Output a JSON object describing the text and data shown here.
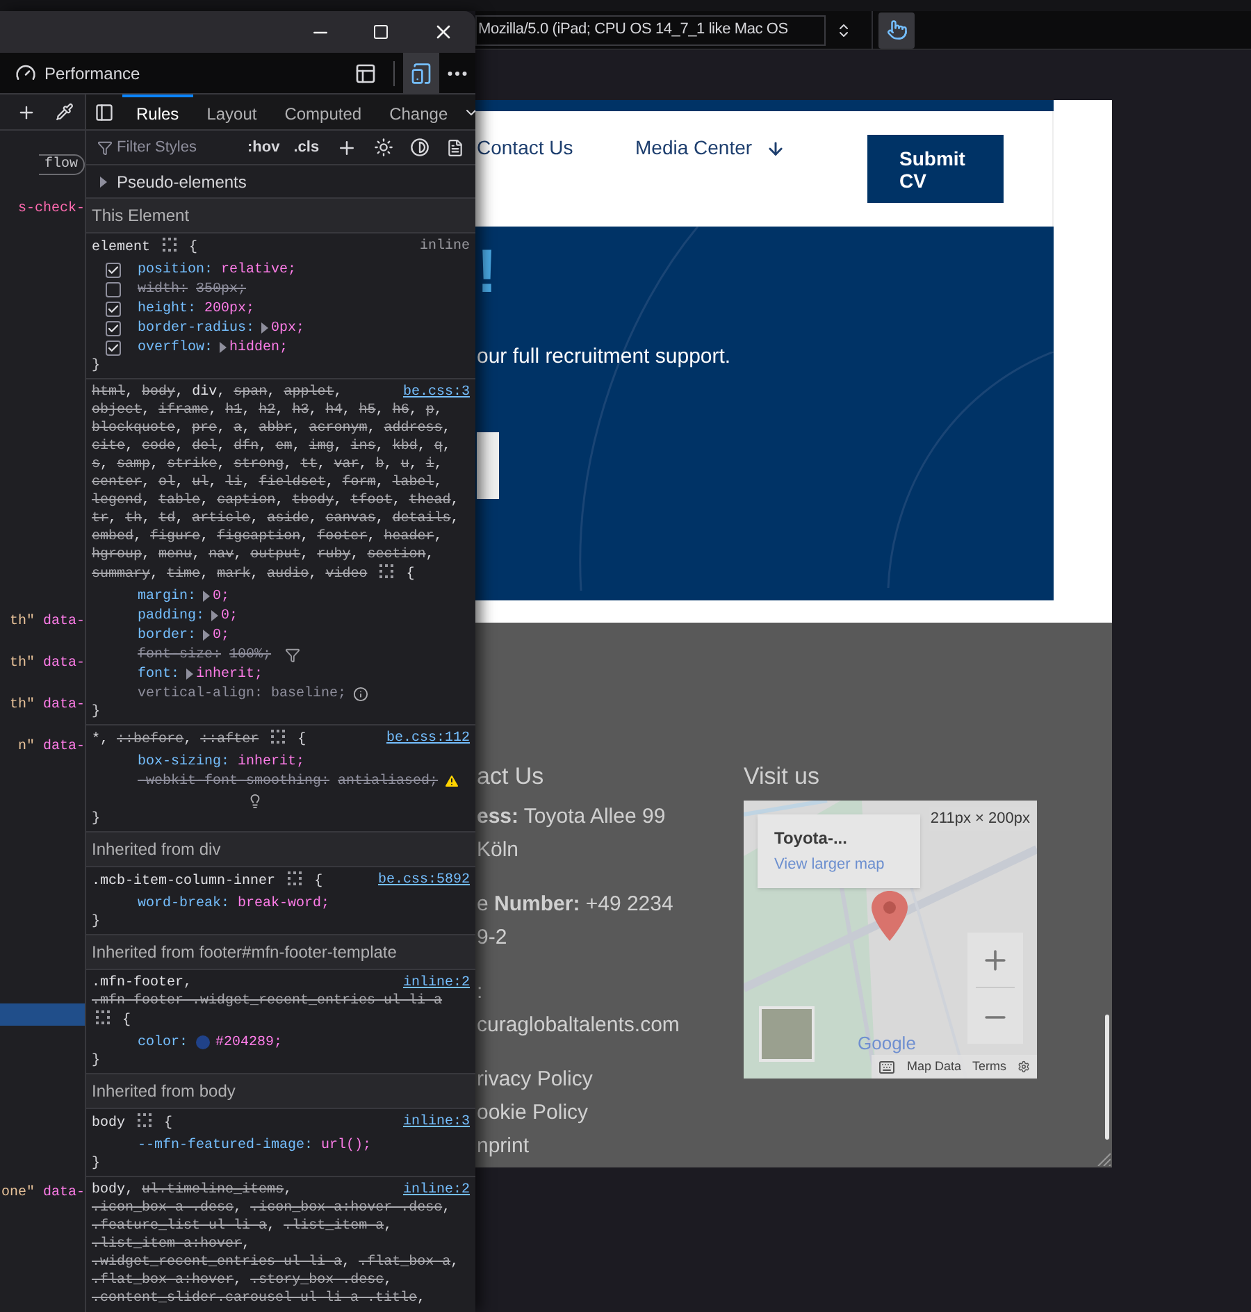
{
  "devtools": {
    "toolbar": {
      "tab": "Performance",
      "responsive_mode": {
        "on": true
      }
    },
    "markup": [
      {
        "kind": "badge",
        "text": "flow",
        "selected": false
      },
      {
        "kind": "attr",
        "text": "s-check-",
        "selected": false
      },
      {
        "kind": "attr_pair",
        "value": "th\"",
        "attr": "data-",
        "selected": false
      },
      {
        "kind": "attr_pair",
        "value": "th\"",
        "attr": "data-",
        "selected": false
      },
      {
        "kind": "attr_pair",
        "value": "th\"",
        "attr": "data-",
        "selected": false
      },
      {
        "kind": "attr_pair",
        "value": "n\"",
        "attr": "data-",
        "selected": false
      },
      {
        "kind": "blank",
        "selected": true
      },
      {
        "kind": "attr_pair",
        "value": "one\"",
        "attr": "data-",
        "selected": false
      }
    ],
    "tabs": [
      {
        "label": "Rules",
        "selected": true
      },
      {
        "label": "Layout",
        "selected": false
      },
      {
        "label": "Computed",
        "selected": false
      },
      {
        "label": "Change",
        "selected": false
      }
    ],
    "filter": {
      "placeholder": "Filter Styles",
      "buttons": [
        ":hov",
        ".cls"
      ]
    },
    "pseudo_elements": "Pseudo-elements",
    "sections": [
      {
        "title": "This Element",
        "rules": [
          {
            "selectors": [
              {
                "text": "element",
                "struck": false
              }
            ],
            "open": "{",
            "close": "}",
            "source": {
              "text": "inline",
              "link": false
            },
            "declarations": [
              {
                "kind": "plain",
                "name": "position:",
                "value": "relative;",
                "checked": true,
                "struck": false,
                "inactive": false
              },
              {
                "kind": "plain",
                "name": "width:",
                "value": "350px;",
                "checked": false,
                "struck": true,
                "inactive": false
              },
              {
                "kind": "plain",
                "name": "height:",
                "value": "200px;",
                "checked": true,
                "struck": false,
                "inactive": false
              },
              {
                "kind": "plain",
                "name": "border-radius:",
                "value": "0px;",
                "checked": true,
                "struck": false,
                "inactive": false,
                "expandable": true
              },
              {
                "kind": "plain",
                "name": "overflow:",
                "value": "hidden;",
                "checked": true,
                "struck": false,
                "inactive": false,
                "expandable": true
              }
            ]
          },
          {
            "selectors": [
              {
                "text": "html",
                "struck": true,
                "sep": ","
              },
              {
                "text": "body",
                "struck": true,
                "sep": ","
              },
              {
                "text": "div",
                "struck": false,
                "sep": ","
              },
              {
                "text": "span",
                "struck": true,
                "sep": ","
              },
              {
                "text": "applet",
                "struck": true,
                "sep": ","
              },
              {
                "text": "object",
                "struck": true,
                "sep": ","
              },
              {
                "text": "iframe",
                "struck": true,
                "sep": ","
              },
              {
                "text": "h1",
                "struck": true,
                "sep": ","
              },
              {
                "text": "h2",
                "struck": true,
                "sep": ","
              },
              {
                "text": "h3",
                "struck": true,
                "sep": ","
              },
              {
                "text": "h4",
                "struck": true,
                "sep": ","
              },
              {
                "text": "h5",
                "struck": true,
                "sep": ","
              },
              {
                "text": "h6",
                "struck": true,
                "sep": ","
              },
              {
                "text": "p",
                "struck": true,
                "sep": ","
              },
              {
                "text": "blockquote",
                "struck": true,
                "sep": ","
              },
              {
                "text": "pre",
                "struck": true,
                "sep": ","
              },
              {
                "text": "a",
                "struck": true,
                "sep": ","
              },
              {
                "text": "abbr",
                "struck": true,
                "sep": ","
              },
              {
                "text": "acronym",
                "struck": true,
                "sep": ","
              },
              {
                "text": "address",
                "struck": true,
                "sep": ","
              },
              {
                "text": "cite",
                "struck": true,
                "sep": ","
              },
              {
                "text": "code",
                "struck": true,
                "sep": ","
              },
              {
                "text": "del",
                "struck": true,
                "sep": ","
              },
              {
                "text": "dfn",
                "struck": true,
                "sep": ","
              },
              {
                "text": "em",
                "struck": true,
                "sep": ","
              },
              {
                "text": "img",
                "struck": true,
                "sep": ","
              },
              {
                "text": "ins",
                "struck": true,
                "sep": ","
              },
              {
                "text": "kbd",
                "struck": true,
                "sep": ","
              },
              {
                "text": "q",
                "struck": true,
                "sep": ","
              },
              {
                "text": "s",
                "struck": true,
                "sep": ","
              },
              {
                "text": "samp",
                "struck": true,
                "sep": ","
              },
              {
                "text": "strike",
                "struck": true,
                "sep": ","
              },
              {
                "text": "strong",
                "struck": true,
                "sep": ","
              },
              {
                "text": "tt",
                "struck": true,
                "sep": ","
              },
              {
                "text": "var",
                "struck": true,
                "sep": ","
              },
              {
                "text": "b",
                "struck": true,
                "sep": ","
              },
              {
                "text": "u",
                "struck": true,
                "sep": ","
              },
              {
                "text": "i",
                "struck": true,
                "sep": ","
              },
              {
                "text": "center",
                "struck": true,
                "sep": ","
              },
              {
                "text": "ol",
                "struck": true,
                "sep": ","
              },
              {
                "text": "ul",
                "struck": true,
                "sep": ","
              },
              {
                "text": "li",
                "struck": true,
                "sep": ","
              },
              {
                "text": "fieldset",
                "struck": true,
                "sep": ","
              },
              {
                "text": "form",
                "struck": true,
                "sep": ","
              },
              {
                "text": "label",
                "struck": true,
                "sep": ","
              },
              {
                "text": "legend",
                "struck": true,
                "sep": ","
              },
              {
                "text": "table",
                "struck": true,
                "sep": ","
              },
              {
                "text": "caption",
                "struck": true,
                "sep": ","
              },
              {
                "text": "tbody",
                "struck": true,
                "sep": ","
              },
              {
                "text": "tfoot",
                "struck": true,
                "sep": ","
              },
              {
                "text": "thead",
                "struck": true,
                "sep": ","
              },
              {
                "text": "tr",
                "struck": true,
                "sep": ","
              },
              {
                "text": "th",
                "struck": true,
                "sep": ","
              },
              {
                "text": "td",
                "struck": true,
                "sep": ","
              },
              {
                "text": "article",
                "struck": true,
                "sep": ","
              },
              {
                "text": "aside",
                "struck": true,
                "sep": ","
              },
              {
                "text": "canvas",
                "struck": true,
                "sep": ","
              },
              {
                "text": "details",
                "struck": true,
                "sep": ","
              },
              {
                "text": "embed",
                "struck": true,
                "sep": ","
              },
              {
                "text": "figure",
                "struck": true,
                "sep": ","
              },
              {
                "text": "figcaption",
                "struck": true,
                "sep": ","
              },
              {
                "text": "footer",
                "struck": true,
                "sep": ","
              },
              {
                "text": "header",
                "struck": true,
                "sep": ","
              },
              {
                "text": "hgroup",
                "struck": true,
                "sep": ","
              },
              {
                "text": "menu",
                "struck": true,
                "sep": ","
              },
              {
                "text": "nav",
                "struck": true,
                "sep": ","
              },
              {
                "text": "output",
                "struck": true,
                "sep": ","
              },
              {
                "text": "ruby",
                "struck": true,
                "sep": ","
              },
              {
                "text": "section",
                "struck": true,
                "sep": ","
              },
              {
                "text": "summary",
                "struck": true,
                "sep": ","
              },
              {
                "text": "time",
                "struck": true,
                "sep": ","
              },
              {
                "text": "mark",
                "struck": true,
                "sep": ","
              },
              {
                "text": "audio",
                "struck": true,
                "sep": ","
              },
              {
                "text": "video",
                "struck": true
              }
            ],
            "open": "{",
            "close": "}",
            "source": {
              "text": "be.css:3",
              "link": true
            },
            "declarations": [
              {
                "kind": "plain",
                "name": "margin:",
                "value": "0;",
                "struck": false,
                "inactive": false,
                "expandable": true
              },
              {
                "kind": "plain",
                "name": "padding:",
                "value": "0;",
                "struck": false,
                "inactive": false,
                "expandable": true
              },
              {
                "kind": "plain",
                "name": "border:",
                "value": "0;",
                "struck": false,
                "inactive": false,
                "expandable": true
              },
              {
                "kind": "filtered",
                "name": "font-size:",
                "value": "100%;",
                "struck": true,
                "inactive": false
              },
              {
                "kind": "plain",
                "name": "font:",
                "value": "inherit;",
                "struck": false,
                "inactive": false,
                "expandable": true
              },
              {
                "kind": "info",
                "name": "vertical-align:",
                "value": "baseline;",
                "struck": false,
                "inactive": true
              }
            ]
          },
          {
            "selectors": [
              {
                "text": "*",
                "struck": false,
                "sep": ","
              },
              {
                "text": "::before",
                "struck": true,
                "sep": ","
              },
              {
                "text": "::after",
                "struck": true
              }
            ],
            "open": "{",
            "close": "}",
            "source": {
              "text": "be.css:112",
              "link": true
            },
            "declarations": [
              {
                "kind": "plain",
                "name": "box-sizing:",
                "value": "inherit;",
                "struck": false,
                "inactive": false
              },
              {
                "kind": "warning",
                "name": "-webkit-font-smoothing:",
                "value": "antialiased;",
                "struck": true,
                "inactive": false,
                "hint": true
              }
            ]
          }
        ]
      },
      {
        "title": "Inherited from div",
        "rules": [
          {
            "selectors": [
              {
                "text": ".mcb-item-column-inner",
                "struck": false
              }
            ],
            "open": "{",
            "close": "}",
            "source": {
              "text": "be.css:5892",
              "link": true
            },
            "declarations": [
              {
                "kind": "plain",
                "name": "word-break:",
                "value": "break-word;",
                "struck": false,
                "inactive": false
              }
            ]
          }
        ]
      },
      {
        "title": "Inherited from footer#mfn-footer-template",
        "rules": [
          {
            "selectors": [
              {
                "text": ".mfn-footer",
                "struck": false,
                "sep": ","
              },
              {
                "text": ".mfn-footer .widget_recent_entries ul li a",
                "struck": true
              }
            ],
            "open": "{",
            "close": "}",
            "source": {
              "text": "inline:2",
              "link": true
            },
            "declarations": [
              {
                "kind": "plain",
                "name": "color:",
                "value": "#204289;",
                "struck": false,
                "inactive": false,
                "color": "#204289"
              }
            ]
          }
        ]
      },
      {
        "title": "Inherited from body",
        "rules": [
          {
            "selectors": [
              {
                "text": "body",
                "struck": false
              }
            ],
            "open": "{",
            "close": "}",
            "source": {
              "text": "inline:3",
              "link": true
            },
            "declarations": [
              {
                "kind": "plain",
                "name": "--mfn-featured-image:",
                "value": "url();",
                "struck": false,
                "inactive": false
              }
            ]
          },
          {
            "selectors": [
              {
                "text": "body",
                "struck": false,
                "sep": ","
              },
              {
                "text": "ul.timeline_items",
                "struck": true,
                "sep": ","
              },
              {
                "text": ".icon_box a .desc",
                "struck": true,
                "sep": ","
              },
              {
                "text": ".icon_box a:hover .desc",
                "struck": true,
                "sep": ","
              },
              {
                "text": ".feature_list ul li a",
                "struck": true,
                "sep": ","
              },
              {
                "text": ".list_item a",
                "struck": true,
                "sep": ","
              },
              {
                "text": ".list_item a:hover",
                "struck": true,
                "sep": ","
              },
              {
                "text": ".widget_recent_entries ul li a",
                "struck": true,
                "sep": ","
              },
              {
                "text": ".flat_box a",
                "struck": true,
                "sep": ","
              },
              {
                "text": ".flat_box a:hover",
                "struck": true,
                "sep": ","
              },
              {
                "text": ".story_box .desc",
                "struck": true,
                "sep": ","
              },
              {
                "text": ".content_slider.carousel ul li a .title",
                "struck": true,
                "sep": ","
              }
            ],
            "source": {
              "text": "inline:2",
              "link": true
            }
          }
        ]
      }
    ]
  },
  "viewport": {
    "user_agent": "Mozilla/5.0 (iPad; CPU OS 14_7_1 like Mac OS",
    "touch_simulation": {
      "on": true
    },
    "header": {
      "nav": [
        "Contact Us",
        "Media Center"
      ],
      "cta": "Submit CV"
    },
    "hero": {
      "headline": "!",
      "text": "our full recruitment support."
    },
    "footer": {
      "contact": {
        "heading": "act Us",
        "blocks": [
          [
            "**ess:** Toyota Allee 99",
            "Köln"
          ],
          [
            "e **Number:** +49 2234",
            "9-2"
          ],
          [
            ":",
            "curaglobaltalents.com"
          ],
          [
            "rivacy Policy",
            "ookie Policy",
            "nprint"
          ]
        ]
      },
      "visit": {
        "heading": "Visit us",
        "map": {
          "place": "Toyota-...",
          "link": "View larger map",
          "size_label": "211px × 200px",
          "logo": "Google",
          "footer_links": [
            "Map Data",
            "Terms"
          ]
        }
      }
    }
  }
}
